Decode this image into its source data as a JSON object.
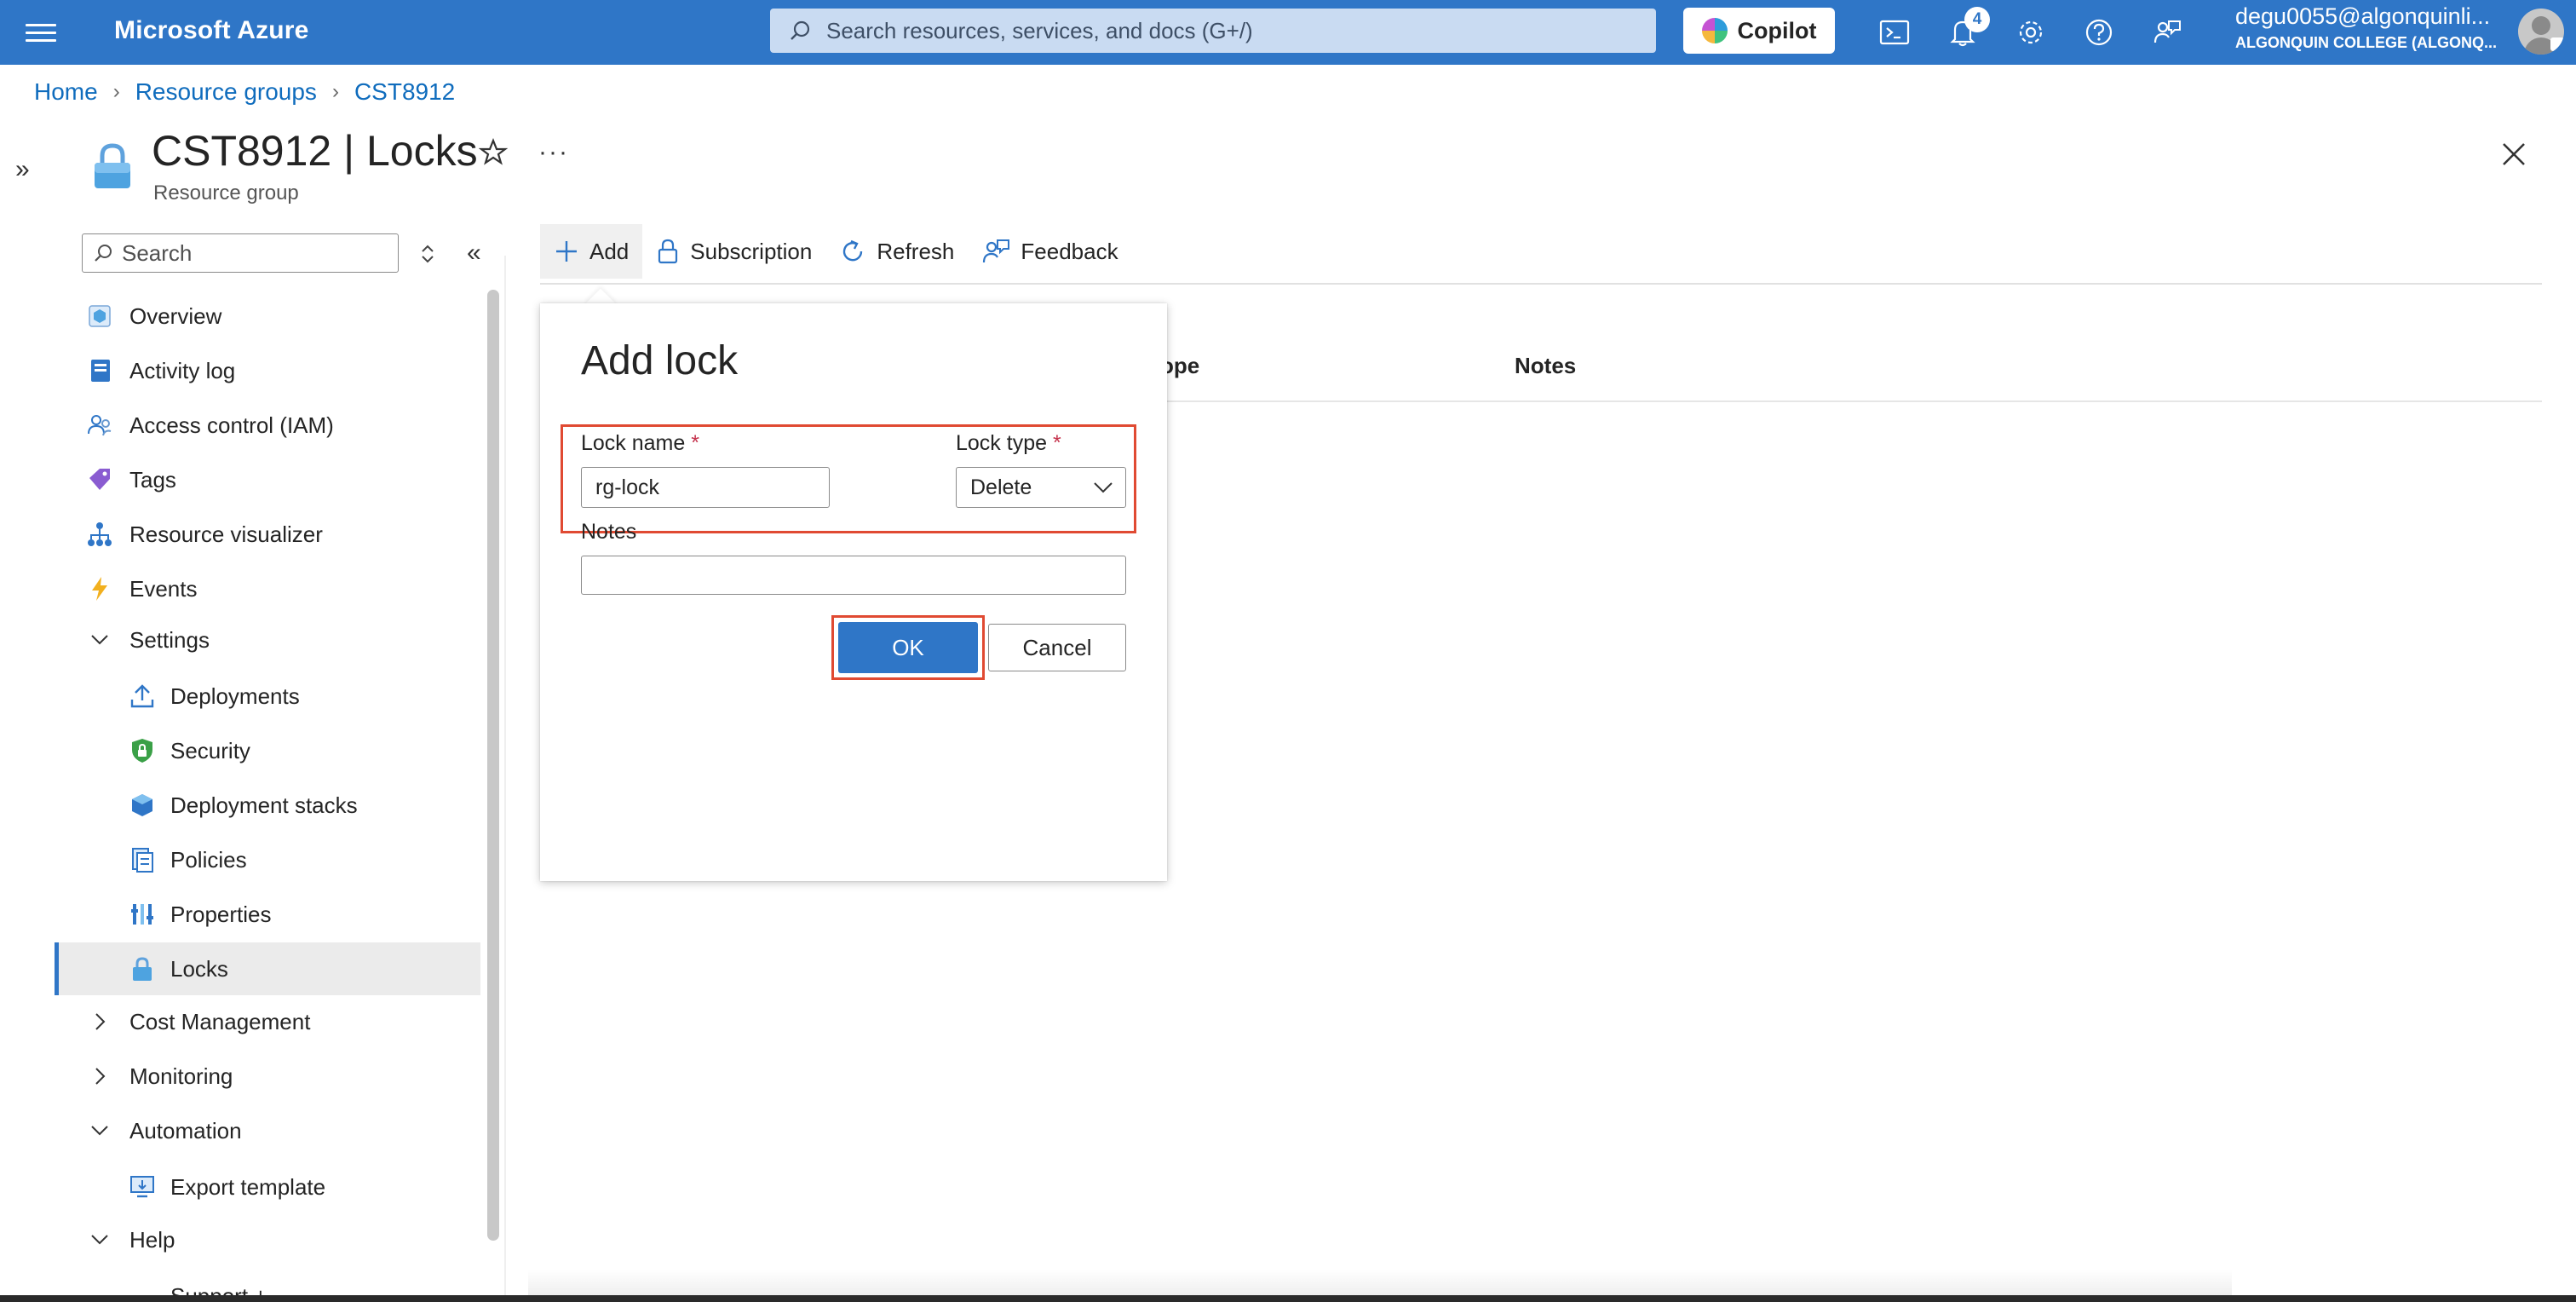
{
  "topbar": {
    "brand": "Microsoft Azure",
    "search_placeholder": "Search resources, services, and docs (G+/)",
    "copilot_label": "Copilot",
    "notification_count": "4",
    "account_email": "degu0055@algonquinli...",
    "account_org": "ALGONQUIN COLLEGE (ALGONQ..."
  },
  "breadcrumb": {
    "items": [
      "Home",
      "Resource groups",
      "CST8912"
    ]
  },
  "blade": {
    "title": "CST8912 | Locks",
    "subtitle": "Resource group"
  },
  "sidebar": {
    "search_placeholder": "Search",
    "items": [
      {
        "label": "Overview"
      },
      {
        "label": "Activity log"
      },
      {
        "label": "Access control (IAM)"
      },
      {
        "label": "Tags"
      },
      {
        "label": "Resource visualizer"
      },
      {
        "label": "Events"
      },
      {
        "label": "Settings"
      },
      {
        "label": "Deployments"
      },
      {
        "label": "Security"
      },
      {
        "label": "Deployment stacks"
      },
      {
        "label": "Policies"
      },
      {
        "label": "Properties"
      },
      {
        "label": "Locks"
      },
      {
        "label": "Cost Management"
      },
      {
        "label": "Monitoring"
      },
      {
        "label": "Automation"
      },
      {
        "label": "Export template"
      },
      {
        "label": "Help"
      },
      {
        "label": "Support +"
      }
    ],
    "active": "Locks"
  },
  "toolbar": {
    "add": "Add",
    "subscription": "Subscription",
    "refresh": "Refresh",
    "feedback": "Feedback"
  },
  "table": {
    "columns_visible": [
      "ope",
      "Notes"
    ]
  },
  "dialog": {
    "title": "Add lock",
    "lock_name_label": "Lock name",
    "lock_name_value": "rg-lock",
    "lock_type_label": "Lock type",
    "lock_type_value": "Delete",
    "required_marker": "*",
    "notes_label": "Notes",
    "notes_value": "",
    "ok_label": "OK",
    "cancel_label": "Cancel"
  },
  "colors": {
    "topbar": "#2f76c7",
    "accent": "#2f76c7",
    "highlight": "#e04a32",
    "required": "#c4314b"
  }
}
